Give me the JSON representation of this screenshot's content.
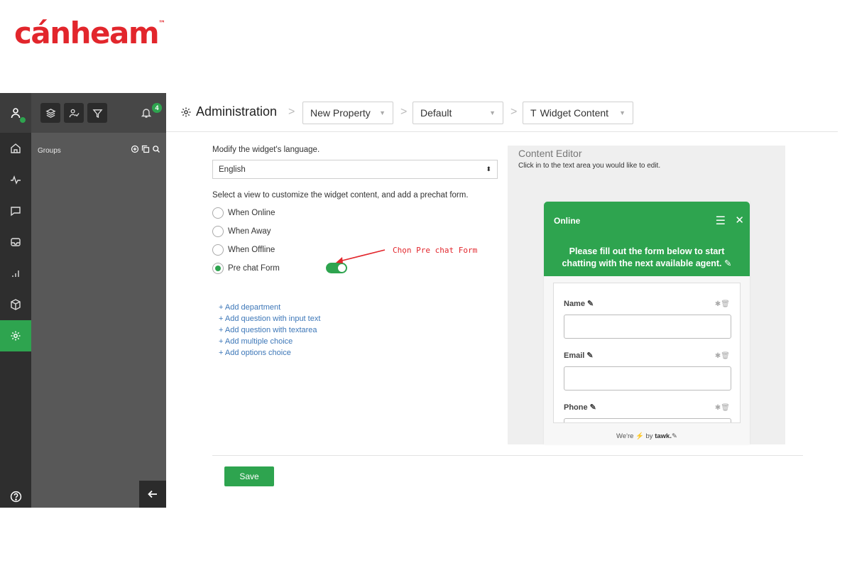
{
  "brand": {
    "logo_text": "cánheam",
    "logo_mark": "™",
    "color": "#e2262c"
  },
  "sidebar": {
    "notifications_count": "4",
    "groups_label": "Groups",
    "rail_items": [
      "home-icon",
      "activity-icon",
      "chat-icon",
      "inbox-icon",
      "reports-icon",
      "addons-icon",
      "settings-icon"
    ],
    "active_item": "settings-icon"
  },
  "header": {
    "title": "Administration",
    "property": "New Property",
    "widget": "Default",
    "section": "Widget Content"
  },
  "form": {
    "language_label": "Modify the widget's language.",
    "language_value": "English",
    "view_label": "Select a view to customize the widget content, and add a prechat form.",
    "views": [
      "When Online",
      "When Away",
      "When Offline",
      "Pre chat Form"
    ],
    "selected_view": "Pre chat Form",
    "prechat_enabled": true,
    "add_links": [
      "+ Add department",
      "+ Add question with input text",
      "+ Add question with textarea",
      "+ Add multiple choice",
      "+ Add options choice"
    ]
  },
  "annotation": "Chọn Pre chat Form",
  "editor": {
    "title": "Content Editor",
    "subtitle": "Click in to the text area you would like to edit.",
    "widget_status": "Online",
    "widget_message": "Please fill out the form below to start chatting with the next available agent.",
    "fields": [
      "Name",
      "Email",
      "Phone"
    ],
    "footer_prefix": "We're",
    "footer_suffix": "by",
    "footer_brand": "tawk."
  },
  "actions": {
    "save_label": "Save"
  },
  "colors": {
    "accent": "#2ea44f",
    "rail": "#2e2e2e",
    "panel": "#585858"
  }
}
